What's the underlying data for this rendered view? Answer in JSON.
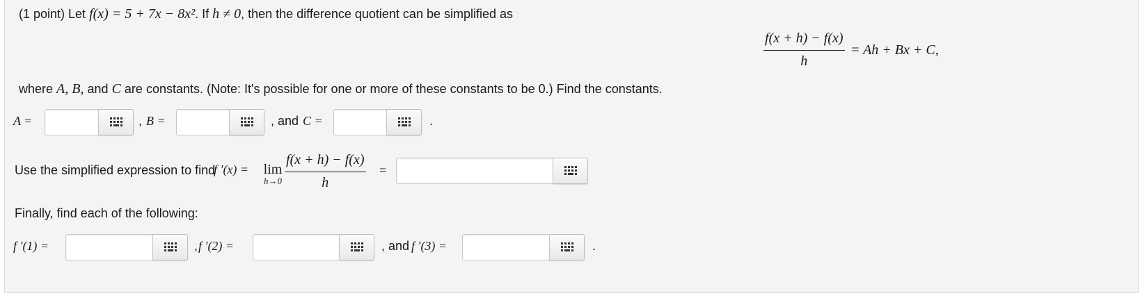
{
  "problem": {
    "intro_prefix": "(1 point) Let",
    "function_def": "f(x) = 5 + 7x − 8x²",
    "intro_mid": ". If",
    "condition": "h ≠ 0",
    "intro_suffix": ", then the difference quotient can be simplified as",
    "dq_numerator": "f(x + h) − f(x)",
    "dq_denominator": "h",
    "dq_rhs": "= Ah + Bx + C,",
    "where_prefix": "where",
    "where_consts": "A, B,",
    "where_and": "and",
    "where_c": "C",
    "where_suffix": "are constants. (Note: It's possible for one or more of these constants to be 0.) Find the constants."
  },
  "constants": {
    "a_label": "A =",
    "b_sep": ",",
    "b_label": "B =",
    "c_sep": ", and",
    "c_label": "C =",
    "end": ".",
    "a_value": "",
    "b_value": "",
    "c_value": ""
  },
  "derivative": {
    "prefix": "Use the simplified expression to find",
    "fprime": "f ′(x) =",
    "lim": "lim",
    "lim_sub": "h→0",
    "numerator": "f(x + h) − f(x)",
    "denominator": "h",
    "equals": "=",
    "value": ""
  },
  "finally": {
    "text": "Finally, find each of the following:",
    "f1_label": "f ′(1) =",
    "sep1": ",",
    "f2_label": "f ′(2) =",
    "sep2": ", and",
    "f3_label": "f ′(3) =",
    "end": ".",
    "f1_value": "",
    "f2_value": "",
    "f3_value": ""
  },
  "icons": {
    "keyboard": "keypad-grid-icon"
  },
  "colors": {
    "panel_bg": "#f4f4f4",
    "input_border": "#c8c8c8",
    "text": "#1a1a1a"
  }
}
